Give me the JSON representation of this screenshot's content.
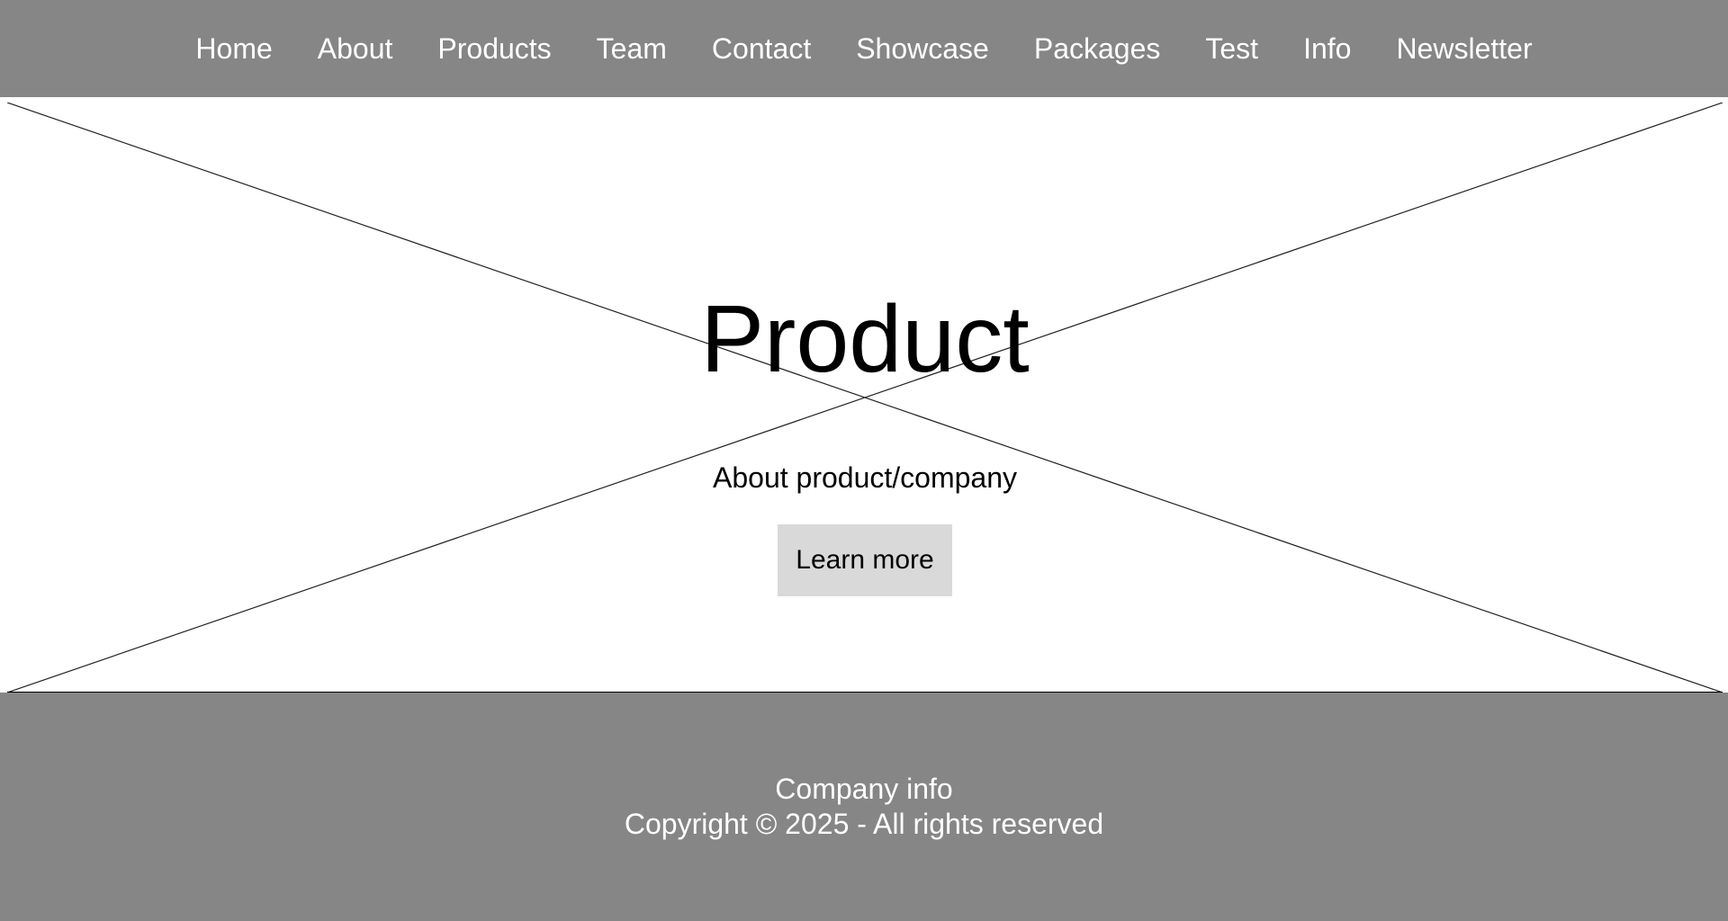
{
  "nav": {
    "items": [
      {
        "label": "Home"
      },
      {
        "label": "About"
      },
      {
        "label": "Products"
      },
      {
        "label": "Team"
      },
      {
        "label": "Contact"
      },
      {
        "label": "Showcase"
      },
      {
        "label": "Packages"
      },
      {
        "label": "Test"
      },
      {
        "label": "Info"
      },
      {
        "label": "Newsletter"
      }
    ]
  },
  "hero": {
    "title": "Product",
    "subtitle": "About product/company",
    "button_label": "Learn more"
  },
  "footer": {
    "company_info": "Company info",
    "copyright": "Copyright © 2025 - All rights reserved"
  },
  "colors": {
    "nav_background": "#868686",
    "footer_background": "#868686",
    "button_background": "#d9d9d9",
    "text_light": "#ffffff",
    "text_dark": "#000000"
  }
}
